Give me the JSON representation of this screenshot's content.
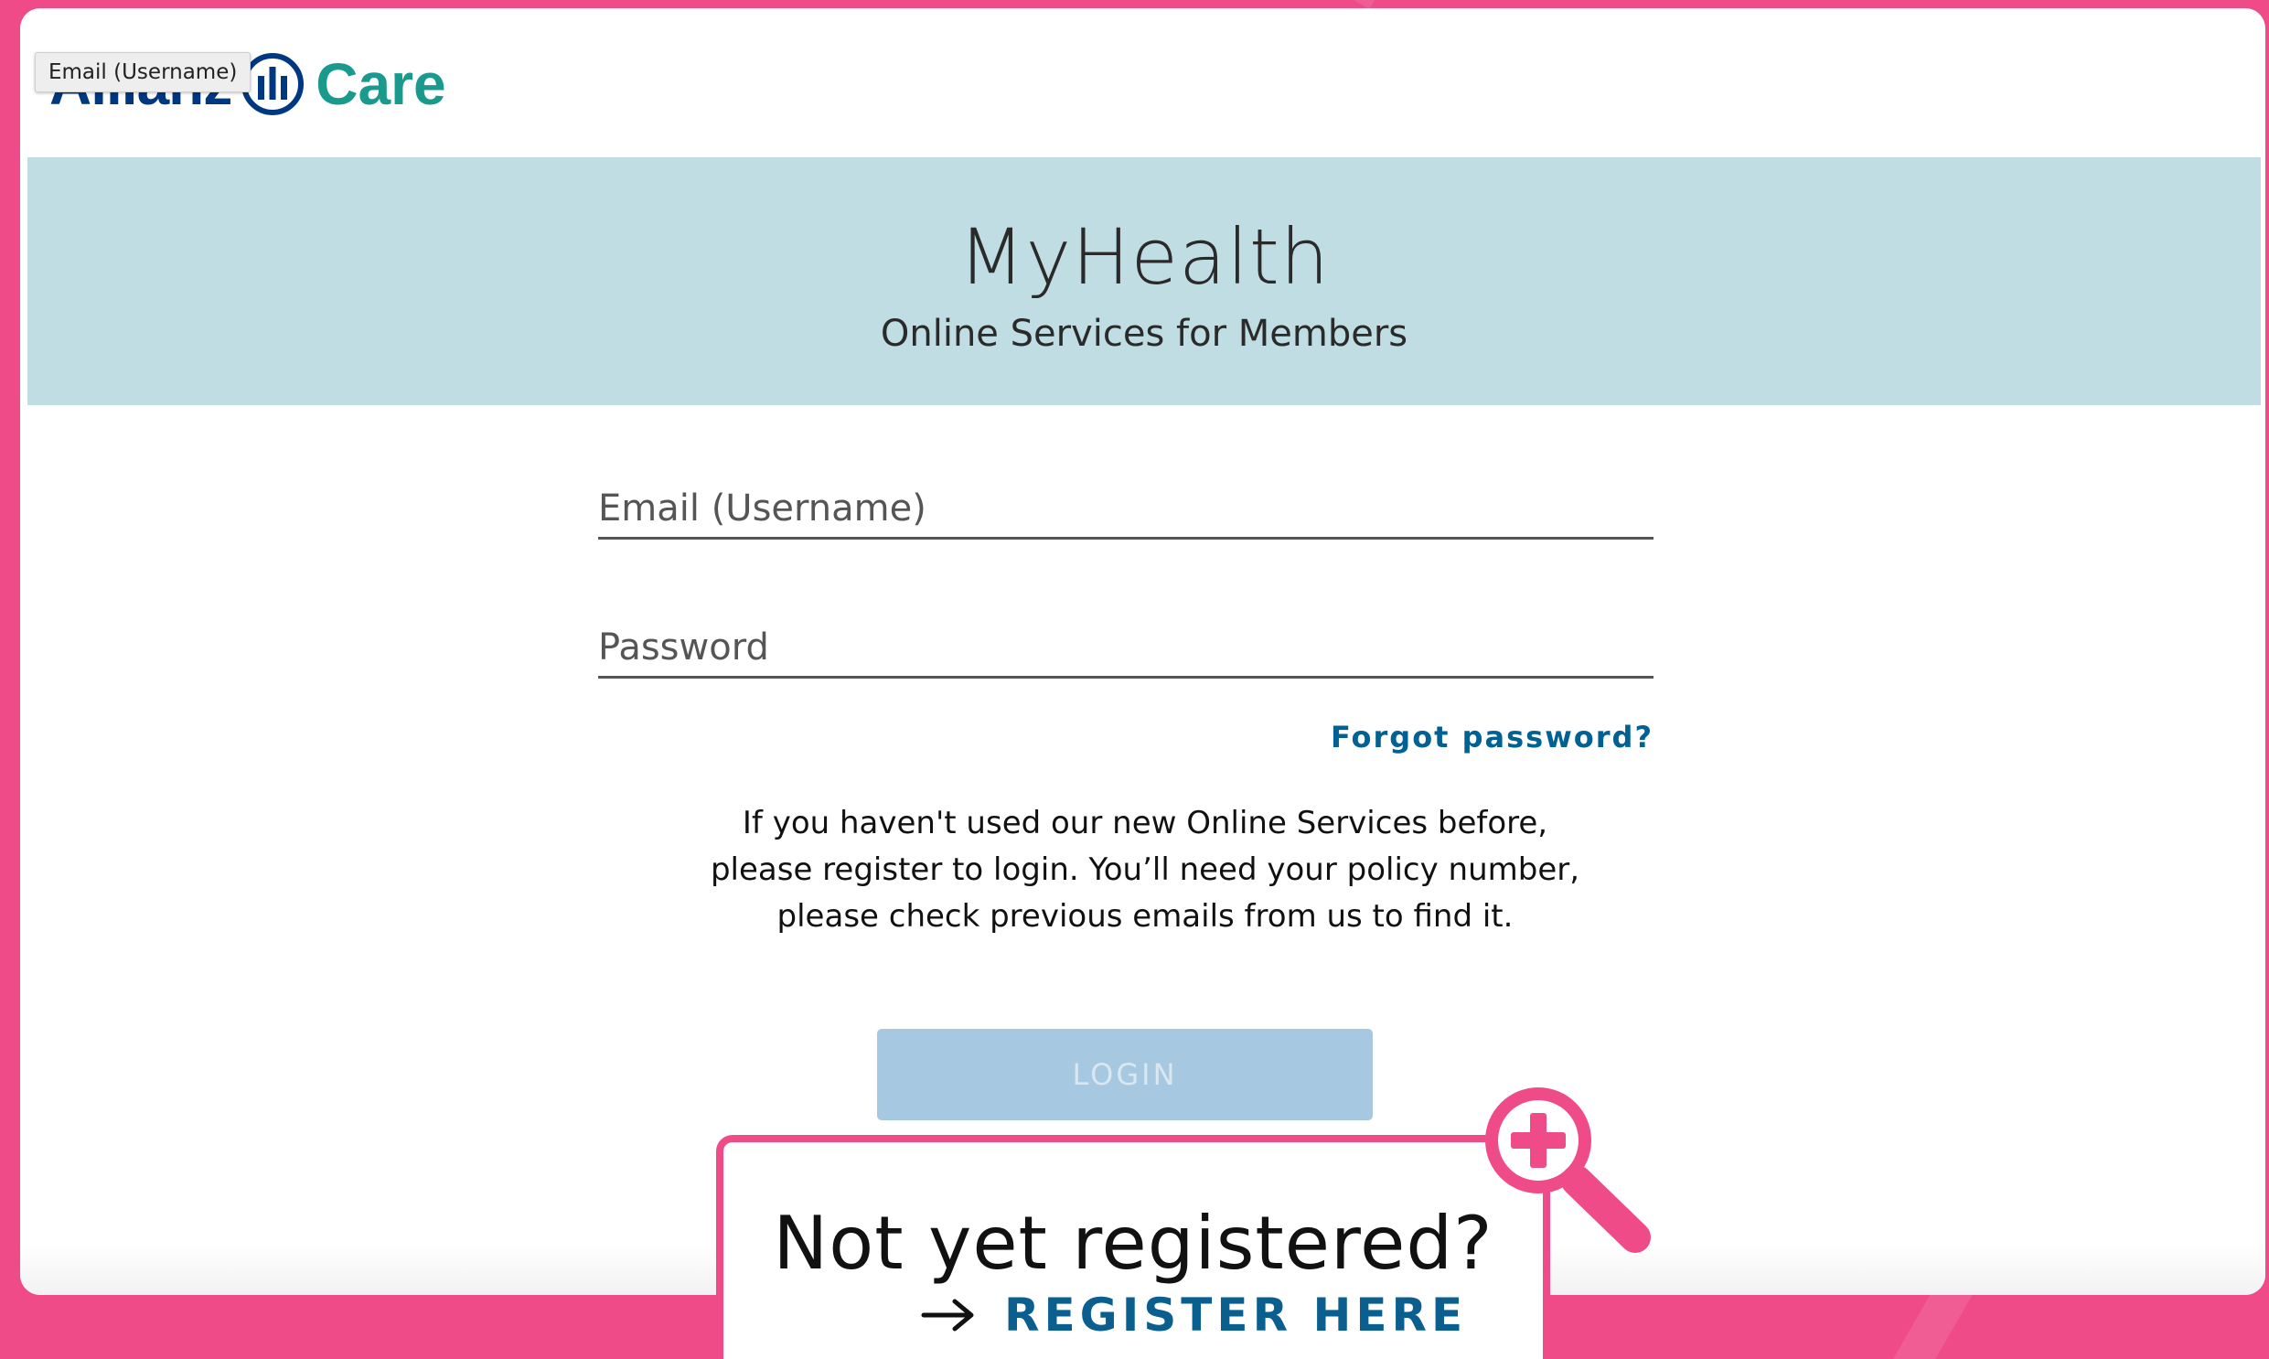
{
  "colors": {
    "page_background": "#ef4b89",
    "banner_background": "#bfdde2",
    "link_blue": "#006192",
    "brand_blue": "#003781",
    "brand_teal": "#1a9a8c",
    "login_disabled": "#a6c8e0",
    "accent_pink": "#ef4b89"
  },
  "header": {
    "logo_word": "Allianz",
    "logo_sub": "Care",
    "logo_icon": "allianz-eagle-icon",
    "tooltip": "Email (Username)"
  },
  "banner": {
    "title": "MyHealth",
    "subtitle": "Online Services for Members"
  },
  "login_form": {
    "email_placeholder": "Email (Username)",
    "email_value": "",
    "password_placeholder": "Password",
    "password_value": "",
    "forgot_password": "Forgot password?",
    "info_lines": [
      "If you haven't used our new Online Services before,",
      "please register to login. You’ll need your policy number,",
      "please check previous emails from us to find it."
    ],
    "login_button": "LOGIN"
  },
  "register_promo": {
    "title": "Not yet registered?",
    "link_text": "REGISTER HERE",
    "arrow_icon": "arrow-right-icon",
    "magnifier_icon": "magnifier-plus-icon"
  }
}
